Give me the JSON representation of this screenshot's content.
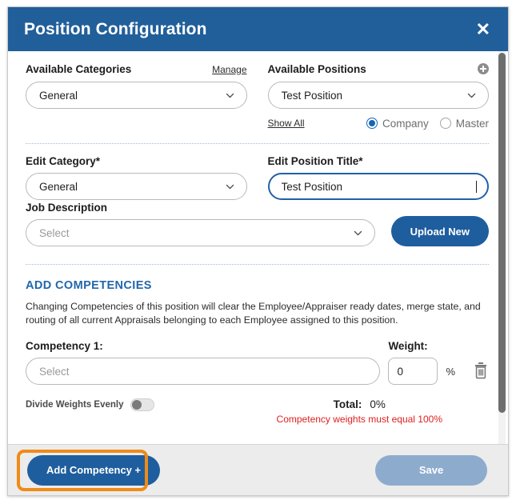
{
  "window": {
    "title": "Position Configuration",
    "close_icon": "close-x-icon"
  },
  "categories": {
    "label": "Available Categories",
    "manage_link": "Manage",
    "select_value": "General",
    "chevron_icon": "chevron-down-icon"
  },
  "positions": {
    "label": "Available Positions",
    "add_icon": "add-circle-icon",
    "select_value": "Test Position",
    "show_all_link": "Show All",
    "scope_options": [
      {
        "label": "Company",
        "selected": true
      },
      {
        "label": "Master",
        "selected": false
      }
    ]
  },
  "edit_category": {
    "label": "Edit Category*",
    "select_value": "General"
  },
  "edit_position_title": {
    "label": "Edit Position Title*",
    "value": "Test Position",
    "focused": true
  },
  "job_description": {
    "label": "Job Description",
    "placeholder": "Select",
    "upload_button": "Upload New"
  },
  "competencies": {
    "section_title": "ADD COMPETENCIES",
    "description": "Changing Competencies of this position will clear the Employee/Appraiser ready dates, merge state, and routing of all current Appraisals belonging to each Employee assigned to this position.",
    "items": [
      {
        "label": "Competency 1:",
        "placeholder": "Select",
        "weight_label": "Weight:",
        "weight_value": "0",
        "percent_symbol": "%",
        "delete_icon": "trash-icon"
      }
    ],
    "divide_evenly_label": "Divide Weights Evenly",
    "divide_evenly_on": false,
    "total_label": "Total:",
    "total_value": "0%",
    "error_text": "Competency weights must equal 100%"
  },
  "footer": {
    "add_competency_button": "Add Competency +",
    "save_button": "Save"
  },
  "colors": {
    "header_blue": "#215f9a",
    "accent_blue": "#1f5e9e",
    "section_blue": "#2266ac",
    "highlight_orange": "#ef8b18",
    "error_red": "#e02020",
    "disabled_blue": "#8daccd"
  }
}
